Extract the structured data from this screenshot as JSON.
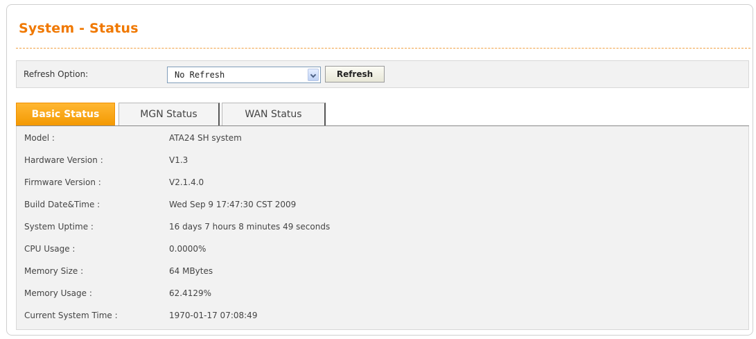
{
  "page": {
    "title": "System - Status"
  },
  "refresh": {
    "label": "Refresh Option:",
    "selected": "No Refresh",
    "button_label": "Refresh"
  },
  "tabs": [
    {
      "label": "Basic Status",
      "active": true
    },
    {
      "label": "MGN Status",
      "active": false
    },
    {
      "label": "WAN Status",
      "active": false
    }
  ],
  "status": [
    {
      "label": "Model :",
      "value": "ATA24 SH system"
    },
    {
      "label": "Hardware Version :",
      "value": "V1.3"
    },
    {
      "label": "Firmware Version :",
      "value": "V2.1.4.0"
    },
    {
      "label": "Build Date&Time :",
      "value": "Wed Sep 9 17:47:30 CST 2009"
    },
    {
      "label": "System Uptime :",
      "value": "16 days 7 hours 8 minutes 49 seconds"
    },
    {
      "label": "CPU Usage :",
      "value": "0.0000%"
    },
    {
      "label": "Memory Size :",
      "value": "64 MBytes"
    },
    {
      "label": "Memory Usage :",
      "value": "62.4129%"
    },
    {
      "label": "Current System Time :",
      "value": "1970-01-17 07:08:49"
    }
  ],
  "colors": {
    "accent": "#f07800",
    "tab_active": "#f39800",
    "panel_bg": "#f2f2f2"
  },
  "icons": {
    "select_arrow": "chevron-down-icon"
  }
}
